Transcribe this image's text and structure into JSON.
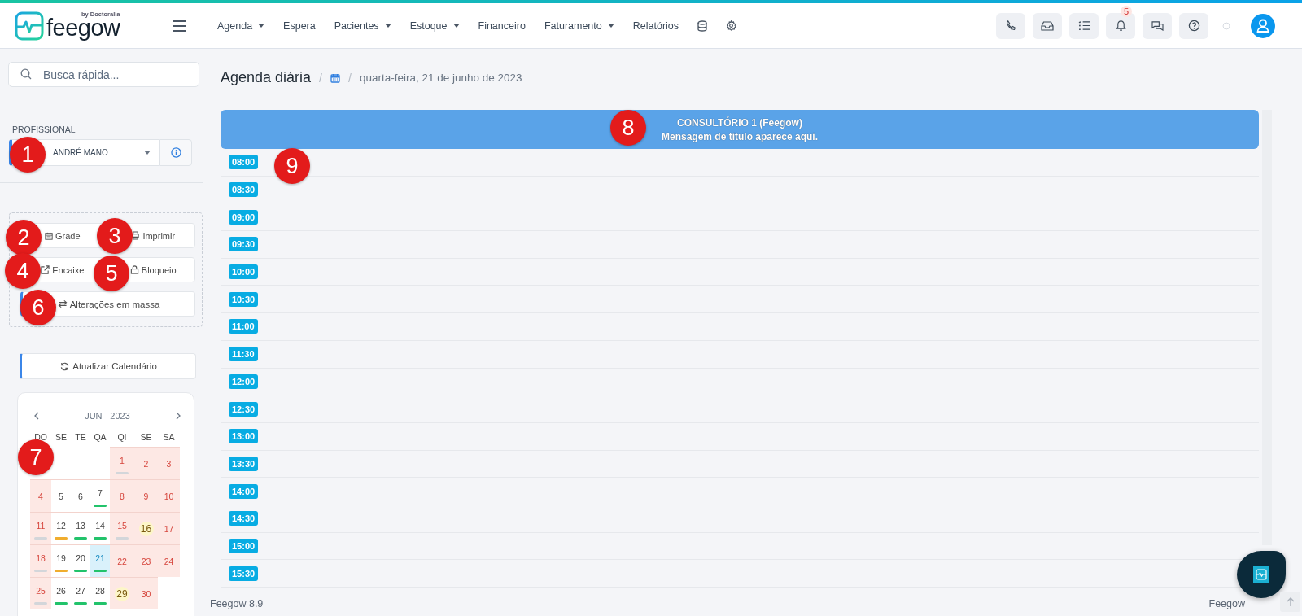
{
  "header": {
    "logo": {
      "name": "feegow",
      "tagline": "by Doctoralia"
    },
    "nav": [
      {
        "label": "Agenda",
        "dropdown": true
      },
      {
        "label": "Espera",
        "dropdown": false
      },
      {
        "label": "Pacientes",
        "dropdown": true
      },
      {
        "label": "Estoque",
        "dropdown": true
      },
      {
        "label": "Financeiro",
        "dropdown": false
      },
      {
        "label": "Faturamento",
        "dropdown": true
      },
      {
        "label": "Relatórios",
        "dropdown": false
      }
    ],
    "nav_icons": [
      {
        "kind": "database"
      },
      {
        "kind": "settings"
      }
    ],
    "toolbar": [
      {
        "kind": "phone"
      },
      {
        "kind": "inbox"
      },
      {
        "kind": "tasks"
      },
      {
        "kind": "bell",
        "badge": "5"
      },
      {
        "kind": "chat"
      },
      {
        "kind": "help"
      }
    ]
  },
  "sidebar": {
    "search": {
      "placeholder": "Busca rápida..."
    },
    "professional": {
      "label": "PROFISSIONAL",
      "value": "ANDRÉ MANO"
    },
    "actions": [
      {
        "label": "Grade",
        "kind": "calendar"
      },
      {
        "label": "Imprimir",
        "kind": "print"
      },
      {
        "label": "Encaixe",
        "kind": "external"
      },
      {
        "label": "Bloqueio",
        "kind": "lock"
      },
      {
        "label": "Alterações em massa",
        "kind": "swap"
      }
    ],
    "refresh": "Atualizar Calendário",
    "calendar": {
      "month": "JUN - 2023",
      "weekdays": [
        "DO",
        "SE",
        "TE",
        "QA",
        "QI",
        "SE",
        "SA"
      ],
      "weeks": [
        [
          {
            "kind": "blank"
          },
          {
            "kind": "blank"
          },
          {
            "kind": "blank"
          },
          {
            "kind": "blank"
          },
          {
            "kind": "day",
            "day": "1",
            "off": true,
            "selected": false,
            "highlight": false,
            "color": "#d3d6da"
          },
          {
            "kind": "day",
            "day": "2",
            "off": true,
            "selected": false,
            "highlight": false
          },
          {
            "kind": "day",
            "day": "3",
            "off": true,
            "selected": false,
            "highlight": false
          }
        ],
        [
          {
            "kind": "day",
            "day": "4",
            "off": true,
            "selected": false,
            "highlight": false
          },
          {
            "kind": "day",
            "day": "5",
            "off": false,
            "selected": false,
            "highlight": false
          },
          {
            "kind": "day",
            "day": "6",
            "off": false,
            "selected": false,
            "highlight": false
          },
          {
            "kind": "day",
            "day": "7",
            "off": false,
            "selected": false,
            "highlight": false,
            "color": "#22c36b"
          },
          {
            "kind": "day",
            "day": "8",
            "off": true,
            "selected": false,
            "highlight": false
          },
          {
            "kind": "day",
            "day": "9",
            "off": true,
            "selected": false,
            "highlight": false
          },
          {
            "kind": "day",
            "day": "10",
            "off": true,
            "selected": false,
            "highlight": false
          }
        ],
        [
          {
            "kind": "day",
            "day": "11",
            "off": true,
            "selected": false,
            "highlight": false,
            "color": "#d3d6da"
          },
          {
            "kind": "day",
            "day": "12",
            "off": false,
            "selected": false,
            "highlight": false,
            "color": "#f0ad2e"
          },
          {
            "kind": "day",
            "day": "13",
            "off": false,
            "selected": false,
            "highlight": false,
            "color": "#22c36b"
          },
          {
            "kind": "day",
            "day": "14",
            "off": false,
            "selected": false,
            "highlight": false,
            "color": "#22c36b"
          },
          {
            "kind": "day",
            "day": "15",
            "off": true,
            "selected": false,
            "highlight": false,
            "color": "#d3d6da"
          },
          {
            "kind": "day",
            "day": "16",
            "off": true,
            "selected": false,
            "highlight": true
          },
          {
            "kind": "day",
            "day": "17",
            "off": true,
            "selected": false,
            "highlight": false
          }
        ],
        [
          {
            "kind": "day",
            "day": "18",
            "off": true,
            "selected": false,
            "highlight": false,
            "color": "#d3d6da"
          },
          {
            "kind": "day",
            "day": "19",
            "off": false,
            "selected": false,
            "highlight": false,
            "color": "#f0ad2e"
          },
          {
            "kind": "day",
            "day": "20",
            "off": false,
            "selected": false,
            "highlight": false,
            "color": "#22c36b"
          },
          {
            "kind": "day",
            "day": "21",
            "off": false,
            "selected": true,
            "highlight": false,
            "color": "#22c36b"
          },
          {
            "kind": "day",
            "day": "22",
            "off": true,
            "selected": false,
            "highlight": false
          },
          {
            "kind": "day",
            "day": "23",
            "off": true,
            "selected": false,
            "highlight": false
          },
          {
            "kind": "day",
            "day": "24",
            "off": true,
            "selected": false,
            "highlight": false
          }
        ],
        [
          {
            "kind": "day",
            "day": "25",
            "off": true,
            "selected": false,
            "highlight": false,
            "color": "#d3d6da"
          },
          {
            "kind": "day",
            "day": "26",
            "off": false,
            "selected": false,
            "highlight": false,
            "color": "#22c36b"
          },
          {
            "kind": "day",
            "day": "27",
            "off": false,
            "selected": false,
            "highlight": false,
            "color": "#22c36b"
          },
          {
            "kind": "day",
            "day": "28",
            "off": false,
            "selected": false,
            "highlight": false,
            "color": "#22c36b"
          },
          {
            "kind": "day",
            "day": "29",
            "off": true,
            "selected": false,
            "highlight": true
          },
          {
            "kind": "day",
            "day": "30",
            "off": true,
            "selected": false,
            "highlight": false
          },
          {
            "kind": "blank"
          }
        ]
      ]
    }
  },
  "main": {
    "title": "Agenda diária",
    "separators": [
      "/",
      "/"
    ],
    "date": "quarta-feira, 21 de junho de 2023",
    "room": {
      "title": "CONSULTÓRIO 1 (Feegow)",
      "message": "Mensagem de título aparece aqui."
    },
    "slots": [
      "08:00",
      "08:30",
      "09:00",
      "09:30",
      "10:00",
      "10:30",
      "11:00",
      "11:30",
      "12:00",
      "12:30",
      "13:00",
      "13:30",
      "14:00",
      "14:30",
      "15:00",
      "15:30"
    ],
    "footer": {
      "version": "Feegow 8.9",
      "brand": "Feegow"
    }
  },
  "markers": [
    "1",
    "2",
    "3",
    "4",
    "5",
    "6",
    "7",
    "8",
    "9"
  ]
}
